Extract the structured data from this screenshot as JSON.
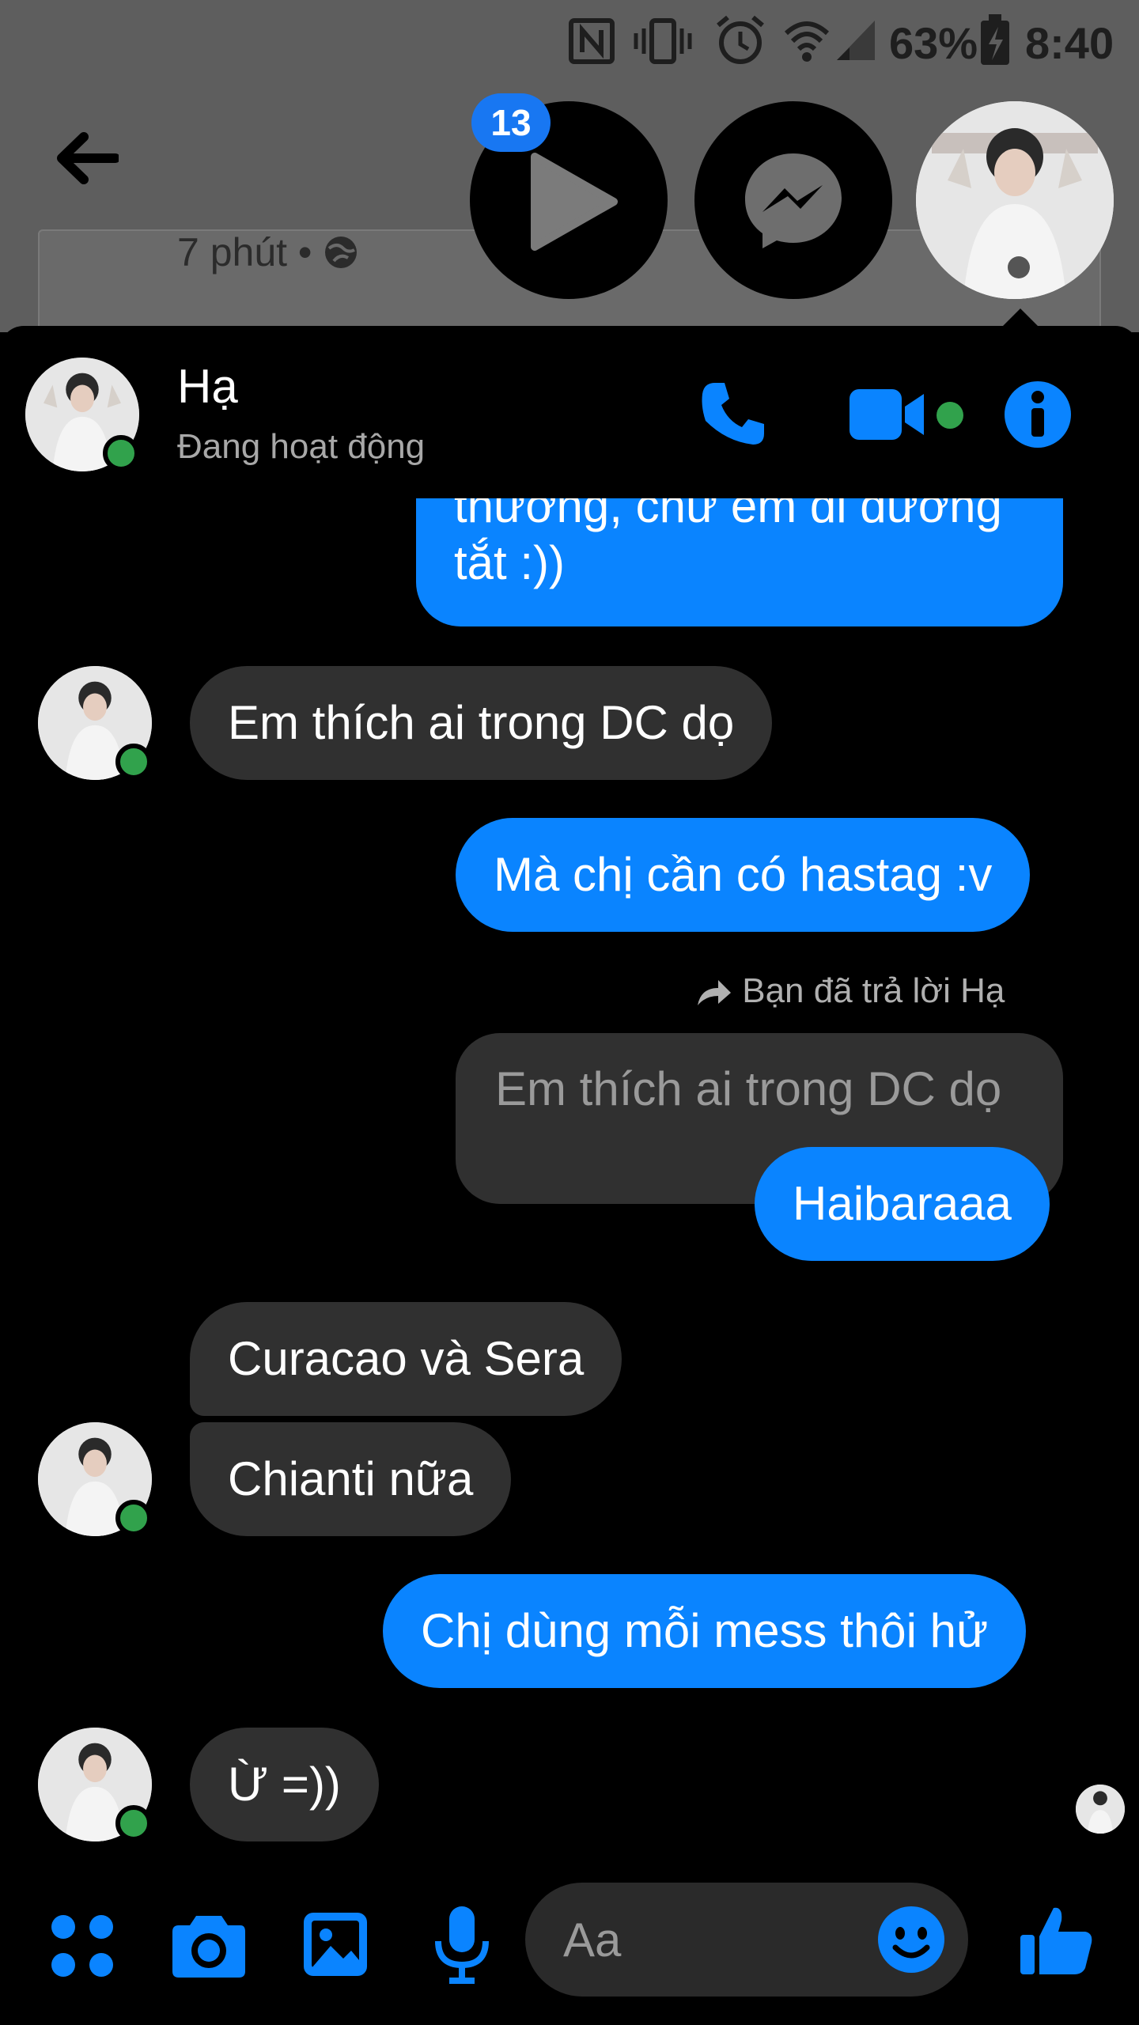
{
  "status_bar": {
    "battery": "63%",
    "time": "8:40"
  },
  "background": {
    "post_time": "7 phút •"
  },
  "chat_heads": {
    "badge_count": "13"
  },
  "header": {
    "name": "Hạ",
    "status": "Đang hoạt động"
  },
  "messages": {
    "m1": "thương, chứ em đi đường\ntắt :))",
    "m2": "Em thích ai trong DC dọ",
    "m3": "Mà chị cần có hastag :v",
    "reply_note": "Bạn đã trả lời Hạ",
    "reply_quote": "Em thích ai trong DC dọ",
    "m4": "Haibaraaa",
    "m5": "Curacao và Sera",
    "m6": "Chianti nữa",
    "m7": "Chị dùng mỗi mess thôi hử",
    "m8": "Ừ =))"
  },
  "composer": {
    "placeholder": "Aa"
  },
  "colors": {
    "accent": "#0a84ff",
    "online": "#31a24c",
    "incoming_bubble": "#303030"
  }
}
